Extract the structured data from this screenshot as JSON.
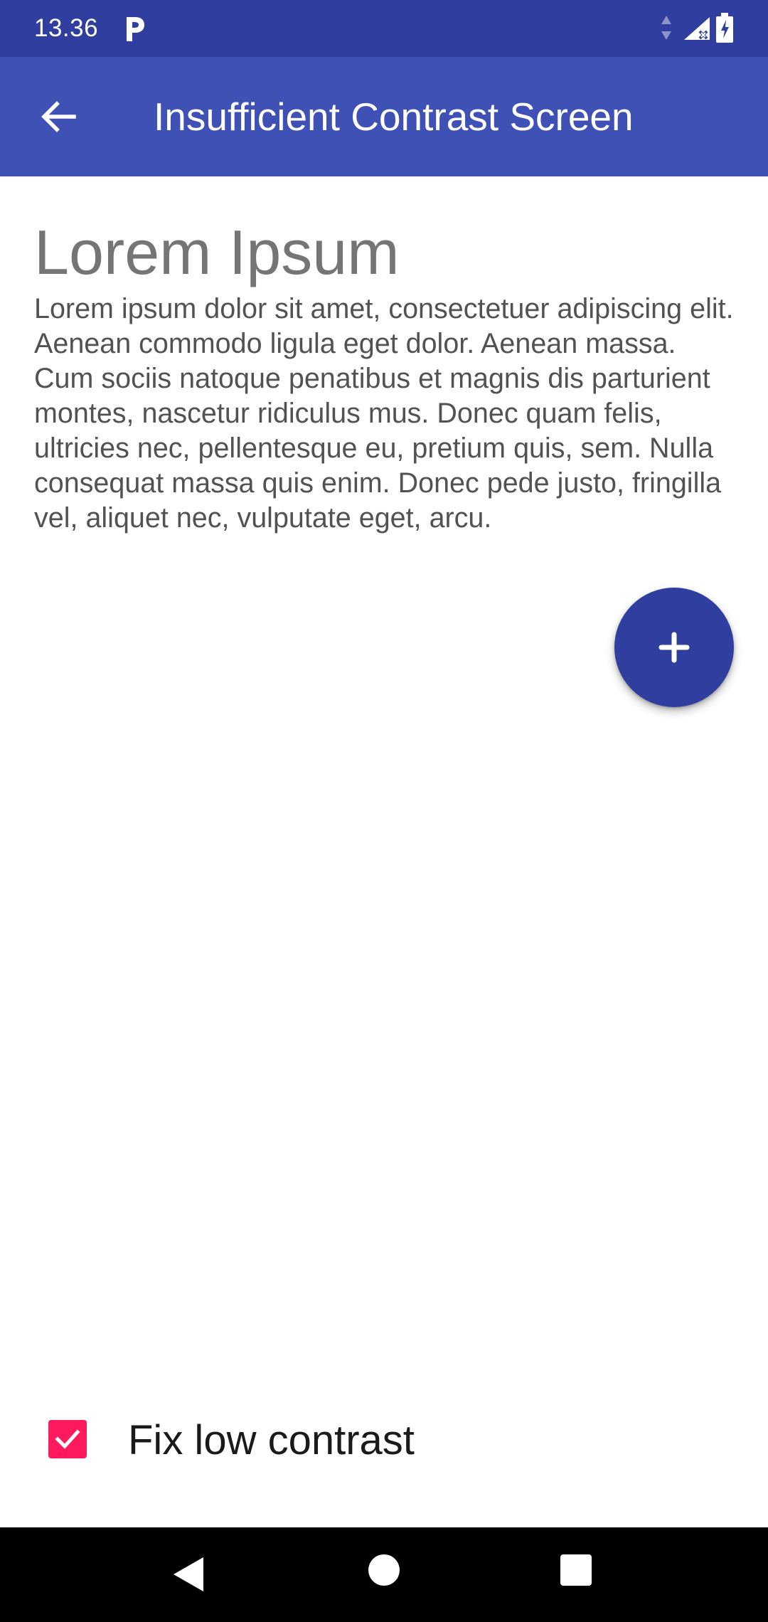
{
  "status_bar": {
    "time": "13.36",
    "background": "#303f9f",
    "icons": [
      "parking-notification-icon",
      "data-arrows-icon",
      "signal-icon",
      "battery-icon"
    ]
  },
  "app_bar": {
    "title": "Insufficient Contrast Screen",
    "background": "#3f51b5",
    "back_icon": "arrow-left-icon"
  },
  "content": {
    "heading": "Lorem Ipsum",
    "body": "Lorem ipsum dolor sit amet, consectetuer adipiscing elit. Aenean commodo ligula eget dolor. Aenean massa. Cum sociis natoque penatibus et magnis dis parturient montes, nascetur ridiculus mus. Donec quam felis, ultricies nec, pellentesque eu, pretium quis, sem. Nulla consequat massa quis enim. Donec pede justo, fringilla vel, aliquet nec, vulputate eget, arcu."
  },
  "fab": {
    "icon": "plus-icon",
    "color": "#303f9f"
  },
  "checkbox": {
    "label": "Fix low contrast",
    "checked": true,
    "color": "#ff1a5e"
  },
  "nav_bar": {
    "icons": [
      "nav-back-icon",
      "nav-home-icon",
      "nav-recents-icon"
    ]
  }
}
